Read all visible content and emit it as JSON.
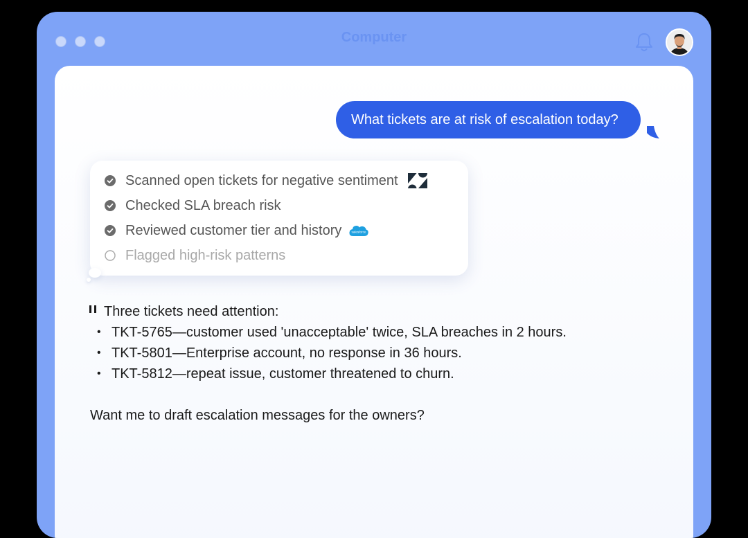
{
  "window": {
    "title": "Computer",
    "accent": "#7ea3f7"
  },
  "header": {
    "notification_icon": "bell-icon",
    "avatar": "user-avatar"
  },
  "chat": {
    "user_message": "What tickets are at risk of escalation today?",
    "steps": [
      {
        "label": "Scanned open tickets for negative sentiment",
        "status": "done",
        "brand_icon": "zendesk-icon"
      },
      {
        "label": "Checked SLA breach risk",
        "status": "done",
        "brand_icon": ""
      },
      {
        "label": "Reviewed customer tier and history",
        "status": "done",
        "brand_icon": "salesforce-icon"
      },
      {
        "label": "Flagged high-risk patterns",
        "status": "pending",
        "brand_icon": ""
      }
    ],
    "salesforce_logo_text": "salesforce",
    "answer": {
      "intro": "Three tickets need attention:",
      "items": [
        "TKT-5765—customer used 'unacceptable' twice, SLA breaches in 2 hours.",
        "TKT-5801—Enterprise account, no response in 36 hours.",
        "TKT-5812—repeat issue, customer threatened to churn."
      ],
      "followup": "Want me to draft escalation messages for the owners?"
    }
  },
  "colors": {
    "user_bubble": "#2f5fe6",
    "salesforce": "#1ea0e0",
    "check_done": "#6b6b6b"
  }
}
